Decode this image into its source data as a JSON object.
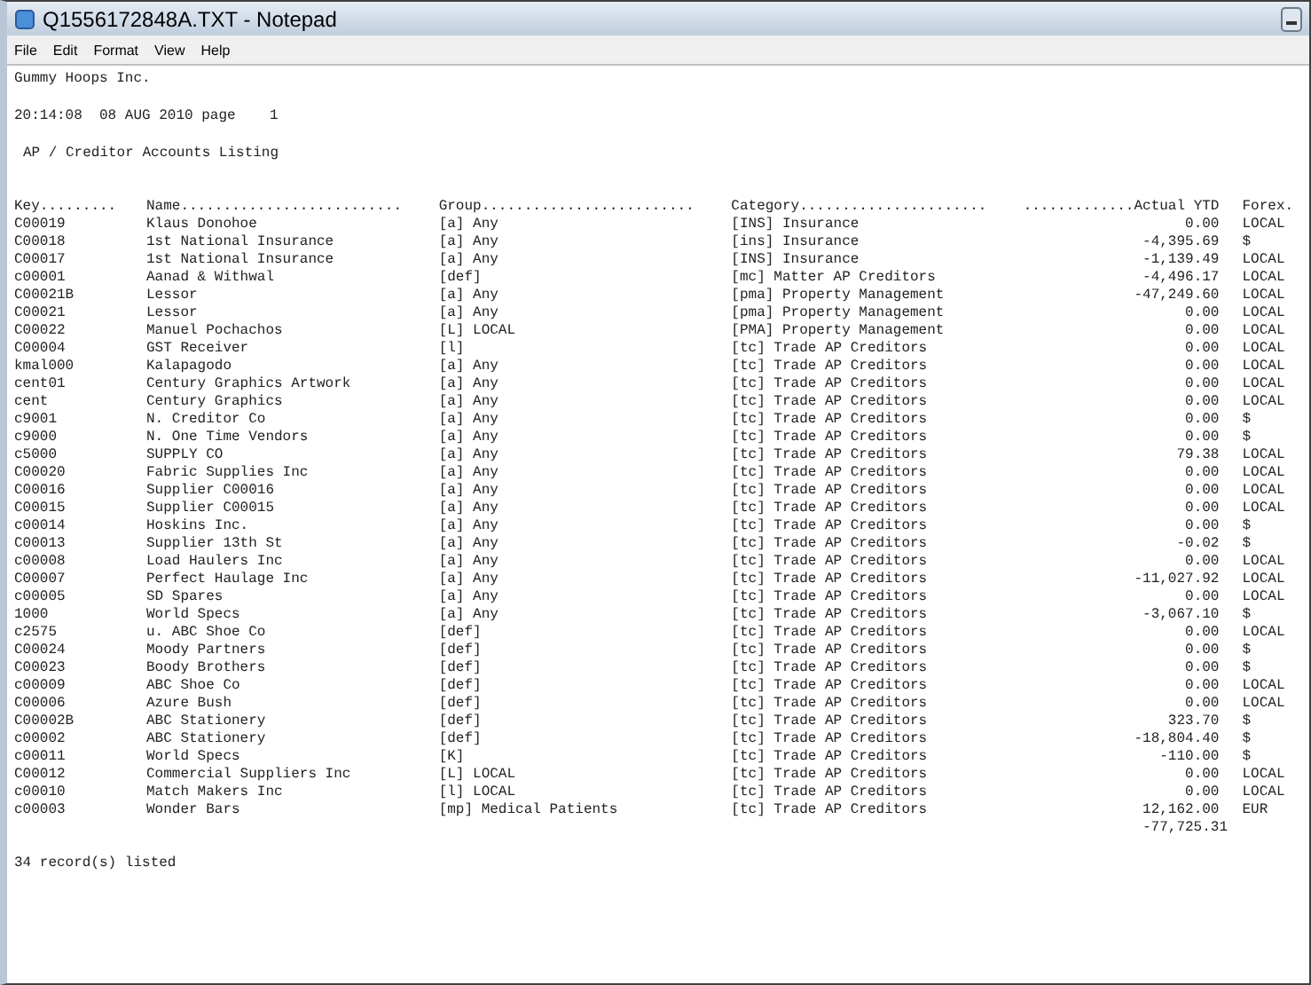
{
  "window": {
    "title": "Q1556172848A.TXT - Notepad"
  },
  "menu": [
    "File",
    "Edit",
    "Format",
    "View",
    "Help"
  ],
  "document": {
    "company": "Gummy Hoops Inc.",
    "timestamp": "20:14:08  08 AUG 2010 page    1",
    "report_title": "AP / Creditor Accounts Listing",
    "columns": [
      "Key.........",
      "Name..........................",
      "Group.........................",
      "Category......................",
      ".............Actual YTD",
      "Forex."
    ],
    "rows": [
      [
        "C00019",
        "Klaus Donohoe",
        "[a] Any",
        "[INS] Insurance",
        "0.00",
        "LOCAL"
      ],
      [
        "C00018",
        "1st National Insurance",
        "[a] Any",
        "[ins] Insurance",
        "-4,395.69",
        "$"
      ],
      [
        "C00017",
        "1st National Insurance",
        "[a] Any",
        "[INS] Insurance",
        "-1,139.49",
        "LOCAL"
      ],
      [
        "c00001",
        "Aanad & Withwal",
        "[def]",
        "[mc] Matter AP Creditors",
        "-4,496.17",
        "LOCAL"
      ],
      [
        "C00021B",
        "Lessor",
        "[a] Any",
        "[pma] Property Management",
        "-47,249.60",
        "LOCAL"
      ],
      [
        "C00021",
        "Lessor",
        "[a] Any",
        "[pma] Property Management",
        "0.00",
        "LOCAL"
      ],
      [
        "C00022",
        "Manuel Pochachos",
        "[L] LOCAL",
        "[PMA] Property Management",
        "0.00",
        "LOCAL"
      ],
      [
        "C00004",
        "GST Receiver",
        "[l]",
        "[tc] Trade AP Creditors",
        "0.00",
        "LOCAL"
      ],
      [
        "kmal000",
        "Kalapagodo",
        "[a] Any",
        "[tc] Trade AP Creditors",
        "0.00",
        "LOCAL"
      ],
      [
        "cent01",
        "Century Graphics Artwork",
        "[a] Any",
        "[tc] Trade AP Creditors",
        "0.00",
        "LOCAL"
      ],
      [
        "cent",
        "Century Graphics",
        "[a] Any",
        "[tc] Trade AP Creditors",
        "0.00",
        "LOCAL"
      ],
      [
        "c9001",
        "N. Creditor Co",
        "[a] Any",
        "[tc] Trade AP Creditors",
        "0.00",
        "$"
      ],
      [
        "c9000",
        "N. One Time Vendors",
        "[a] Any",
        "[tc] Trade AP Creditors",
        "0.00",
        "$"
      ],
      [
        "c5000",
        "SUPPLY CO",
        "[a] Any",
        "[tc] Trade AP Creditors",
        "79.38",
        "LOCAL"
      ],
      [
        "C00020",
        "Fabric Supplies Inc",
        "[a] Any",
        "[tc] Trade AP Creditors",
        "0.00",
        "LOCAL"
      ],
      [
        "C00016",
        "Supplier C00016",
        "[a] Any",
        "[tc] Trade AP Creditors",
        "0.00",
        "LOCAL"
      ],
      [
        "C00015",
        "Supplier C00015",
        "[a] Any",
        "[tc] Trade AP Creditors",
        "0.00",
        "LOCAL"
      ],
      [
        "c00014",
        "Hoskins Inc.",
        "[a] Any",
        "[tc] Trade AP Creditors",
        "0.00",
        "$"
      ],
      [
        "C00013",
        "Supplier 13th St",
        "[a] Any",
        "[tc] Trade AP Creditors",
        "-0.02",
        "$"
      ],
      [
        "c00008",
        "Load Haulers Inc",
        "[a] Any",
        "[tc] Trade AP Creditors",
        "0.00",
        "LOCAL"
      ],
      [
        "C00007",
        "Perfect Haulage Inc",
        "[a] Any",
        "[tc] Trade AP Creditors",
        "-11,027.92",
        "LOCAL"
      ],
      [
        "c00005",
        "SD Spares",
        "[a] Any",
        "[tc] Trade AP Creditors",
        "0.00",
        "LOCAL"
      ],
      [
        "1000",
        "World Specs",
        "[a] Any",
        "[tc] Trade AP Creditors",
        "-3,067.10",
        "$"
      ],
      [
        "c2575",
        "u. ABC Shoe Co",
        "[def]",
        "[tc] Trade AP Creditors",
        "0.00",
        "LOCAL"
      ],
      [
        "C00024",
        "Moody Partners",
        "[def]",
        "[tc] Trade AP Creditors",
        "0.00",
        "$"
      ],
      [
        "C00023",
        "Boody Brothers",
        "[def]",
        "[tc] Trade AP Creditors",
        "0.00",
        "$"
      ],
      [
        "c00009",
        "ABC Shoe Co",
        "[def]",
        "[tc] Trade AP Creditors",
        "0.00",
        "LOCAL"
      ],
      [
        "C00006",
        "Azure Bush",
        "[def]",
        "[tc] Trade AP Creditors",
        "0.00",
        "LOCAL"
      ],
      [
        "C00002B",
        "ABC Stationery",
        "[def]",
        "[tc] Trade AP Creditors",
        "323.70",
        "$"
      ],
      [
        "c00002",
        "ABC Stationery",
        "[def]",
        "[tc] Trade AP Creditors",
        "-18,804.40",
        "$"
      ],
      [
        "c00011",
        "World Specs",
        "[K]",
        "[tc] Trade AP Creditors",
        "-110.00",
        "$"
      ],
      [
        "C00012",
        "Commercial Suppliers Inc",
        "[L] LOCAL",
        "[tc] Trade AP Creditors",
        "0.00",
        "LOCAL"
      ],
      [
        "c00010",
        "Match Makers Inc",
        "[l] LOCAL",
        "[tc] Trade AP Creditors",
        "0.00",
        "LOCAL"
      ],
      [
        "c00003",
        "Wonder Bars",
        "[mp] Medical Patients",
        "[tc] Trade AP Creditors",
        "12,162.00",
        "EUR"
      ]
    ],
    "total": "-77,725.31",
    "footer": "34 record(s) listed"
  }
}
